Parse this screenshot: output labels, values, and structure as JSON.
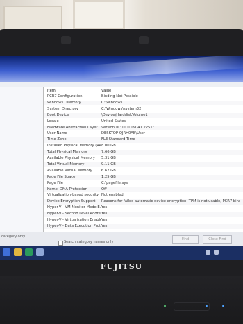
{
  "brand": "FUJITSU",
  "system_info": {
    "columns": {
      "item": "Item",
      "value": "Value"
    },
    "rows": [
      {
        "item": "PCR7 Configuration",
        "value": "Binding Not Possible"
      },
      {
        "item": "Windows Directory",
        "value": "C:\\Windows"
      },
      {
        "item": "System Directory",
        "value": "C:\\Windows\\system32"
      },
      {
        "item": "Boot Device",
        "value": "\\Device\\HarddiskVolume1"
      },
      {
        "item": "Locale",
        "value": "United States"
      },
      {
        "item": "Hardware Abstraction Layer",
        "value": "Version = \"10.0.19041.2251\""
      },
      {
        "item": "User Name",
        "value": "DESKTOP-QJRH0AB\\User"
      },
      {
        "item": "Time Zone",
        "value": "FLE Standard Time"
      },
      {
        "item": "Installed Physical Memory (RAM)",
        "value": "8.00 GB"
      },
      {
        "item": "Total Physical Memory",
        "value": "7.66 GB"
      },
      {
        "item": "Available Physical Memory",
        "value": "5.31 GB"
      },
      {
        "item": "Total Virtual Memory",
        "value": "9.11 GB"
      },
      {
        "item": "Available Virtual Memory",
        "value": "6.62 GB"
      },
      {
        "item": "Page File Space",
        "value": "1.25 GB"
      },
      {
        "item": "Page File",
        "value": "C:\\pagefile.sys"
      },
      {
        "item": "Kernel DMA Protection",
        "value": "Off"
      },
      {
        "item": "Virtualization-based security",
        "value": "Not enabled"
      },
      {
        "item": "Device Encryption Support",
        "value": "Reasons for failed automatic device encryption: TPM is not usable, PCR7 bindi..."
      },
      {
        "item": "Hyper-V - VM Monitor Mode E...",
        "value": "Yes"
      },
      {
        "item": "Hyper-V - Second Level Addres...",
        "value": "Yes"
      },
      {
        "item": "Hyper-V - Virtualization Enable...",
        "value": "Yes"
      },
      {
        "item": "Hyper-V - Data Execution Prote...",
        "value": "Yes"
      }
    ]
  },
  "find_bar": {
    "selected_category_label": "category only",
    "search_names_label": "Search category names only",
    "find_button": "Find",
    "close_find_button": "Close Find"
  },
  "colors": {
    "screen_blue": "#0d2a7a",
    "taskbar": "#1b2f63",
    "row_alt": "#f7f7f9"
  },
  "icons": [
    "start-icon",
    "file-explorer-icon",
    "edge-icon",
    "system-info-icon",
    "network-icon",
    "volume-icon"
  ]
}
